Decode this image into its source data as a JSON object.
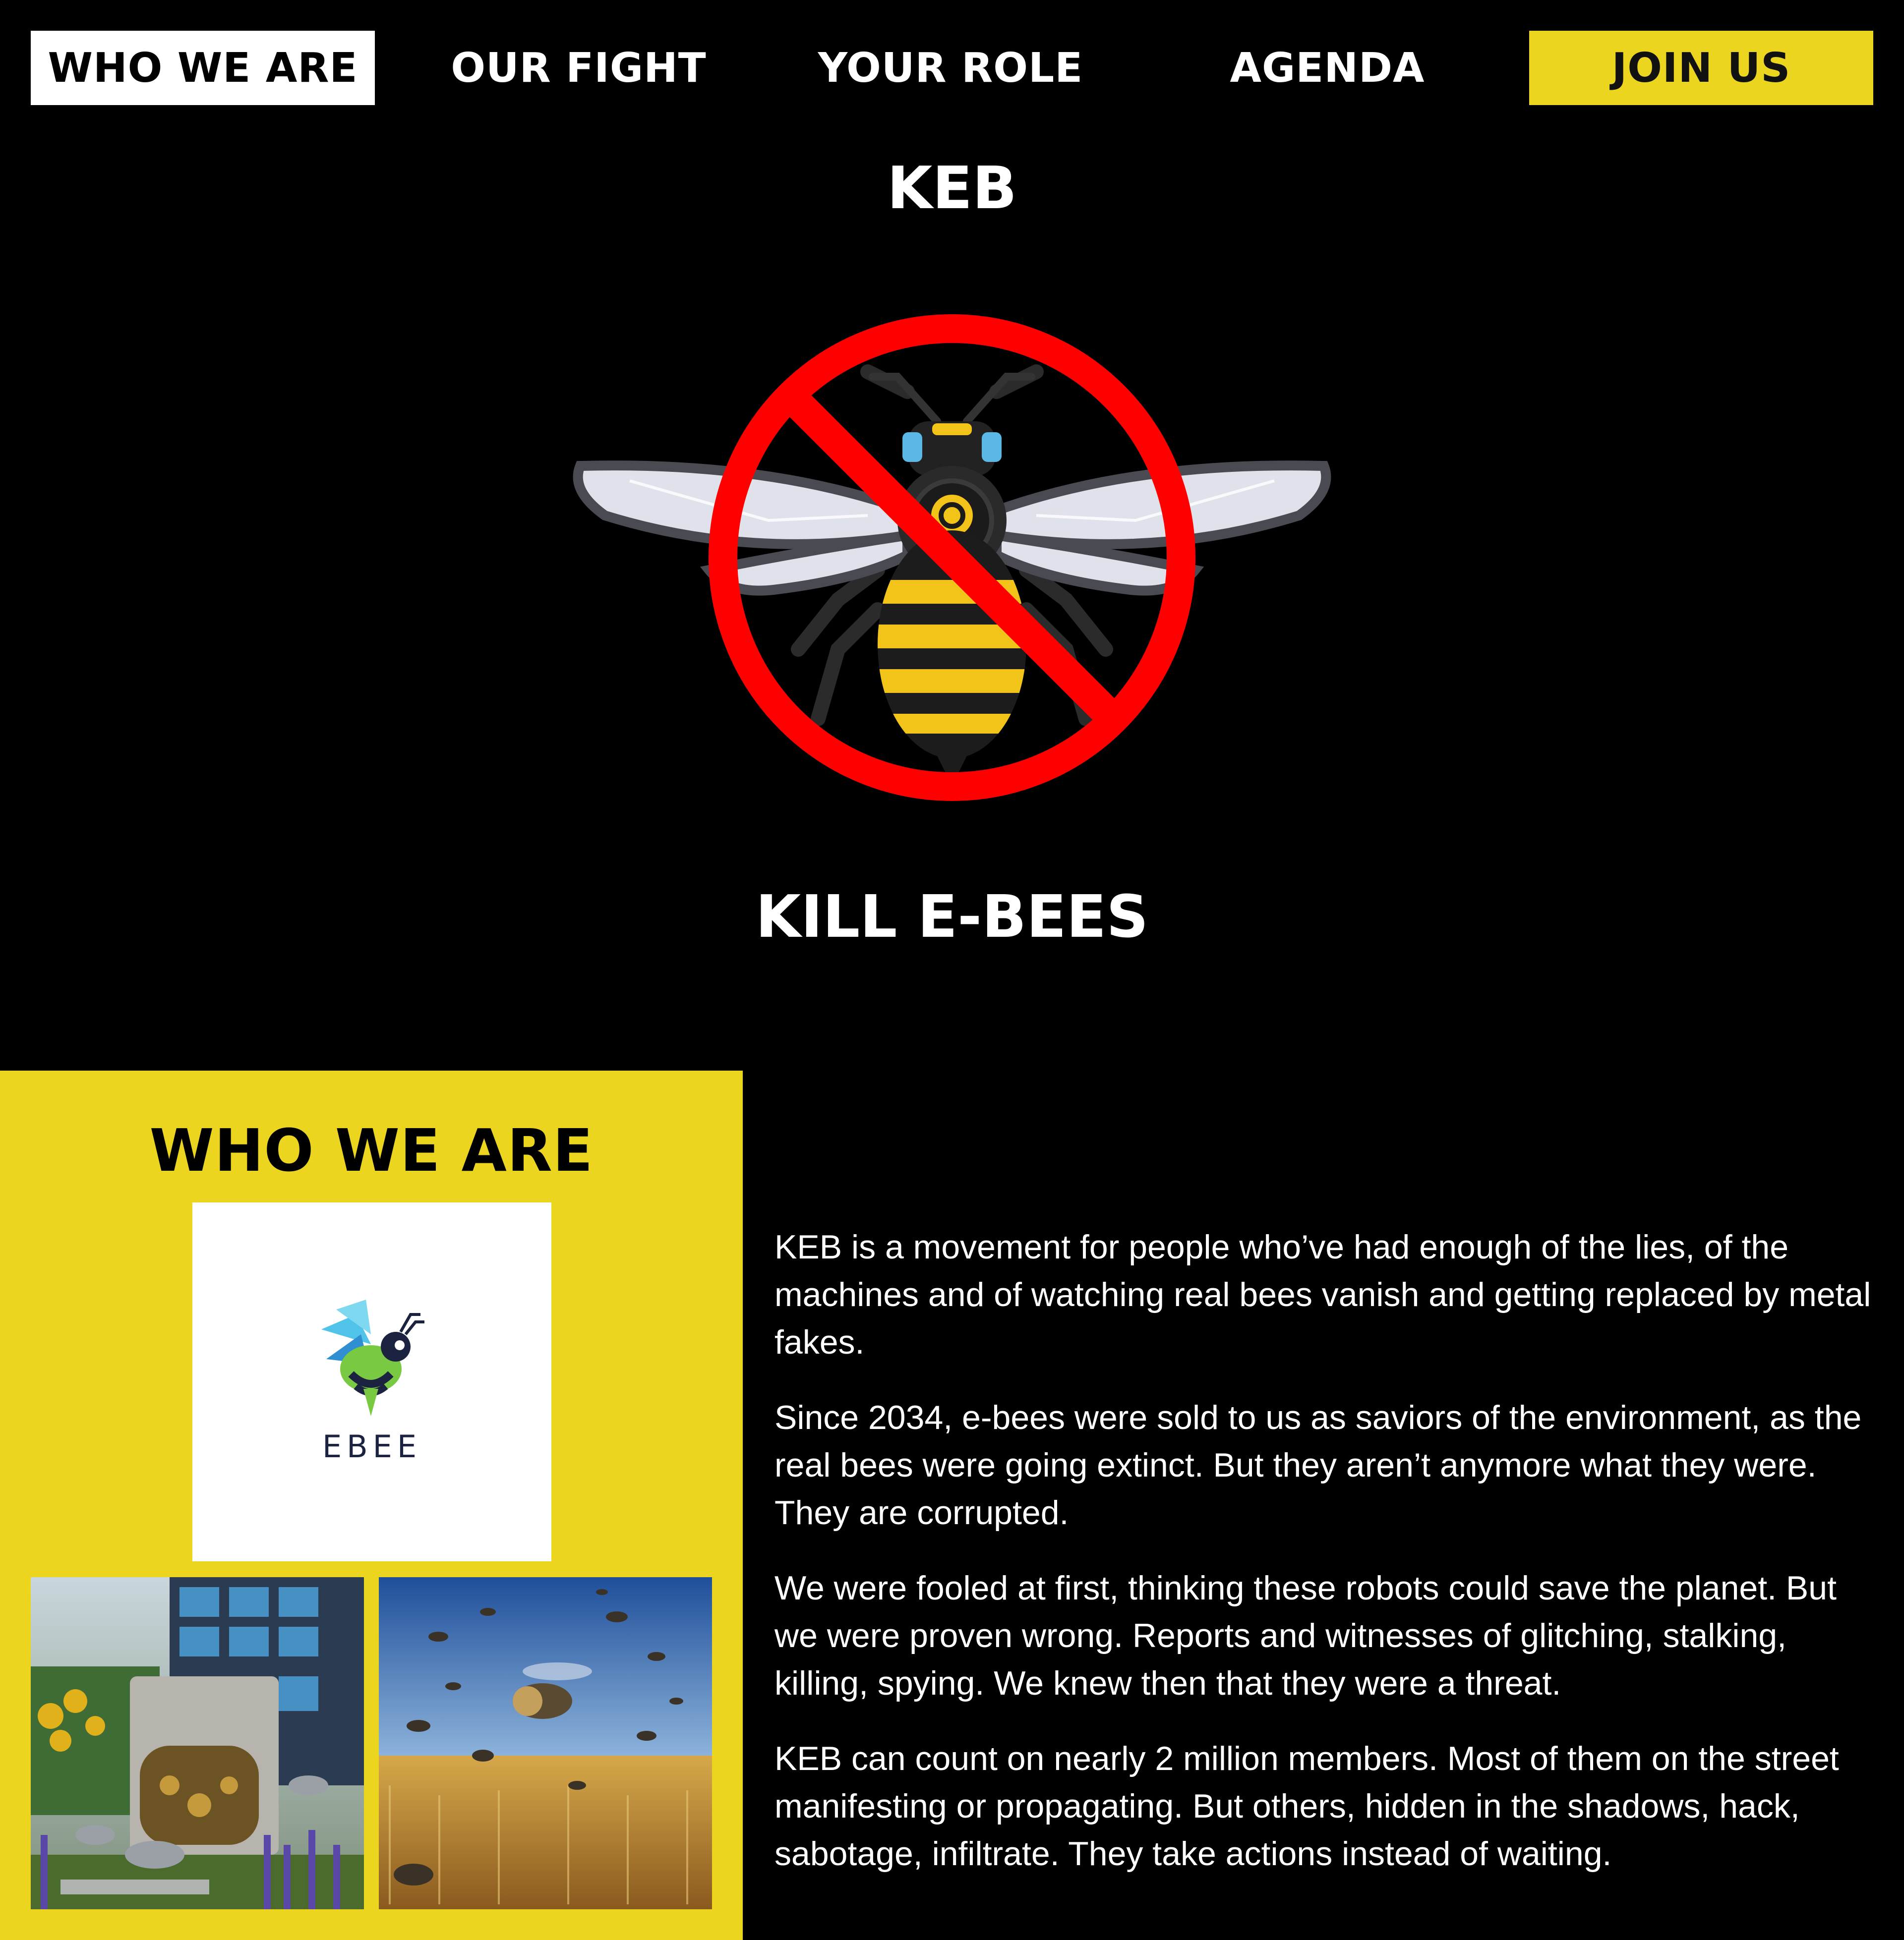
{
  "nav": {
    "items": [
      "WHO WE ARE",
      "OUR FIGHT",
      "YOUR ROLE",
      "AGENDA"
    ],
    "cta": "JOIN US"
  },
  "hero": {
    "brand": "KEB",
    "slogan": "KILL E-BEES",
    "icon": "no-bee-icon"
  },
  "who": {
    "title": "WHO WE ARE",
    "logo_text": "EBEE",
    "paragraphs": [
      "KEB is a movement for people who’ve had enough of the lies, of the machines and of watching real bees vanish and getting replaced by metal fakes.",
      "Since 2034, e-bees were sold to us as saviors of the environment, as the real bees were going extinct. But they aren’t anymore what they were. They are corrupted.",
      "We were fooled at first, thinking these robots could save the planet. But we were proven wrong. Reports and witnesses of glitching, stalking, killing, spying. We knew then that they were a threat.",
      "KEB can count on nearly 2 million members. Most of them on the street manifesting or propagating. But others, hidden in the shadows, hack, sabotage, infiltrate. They take actions instead of waiting."
    ]
  },
  "colors": {
    "accent": "#ecd51e",
    "background": "#000000",
    "prohibit": "#ff0000"
  }
}
